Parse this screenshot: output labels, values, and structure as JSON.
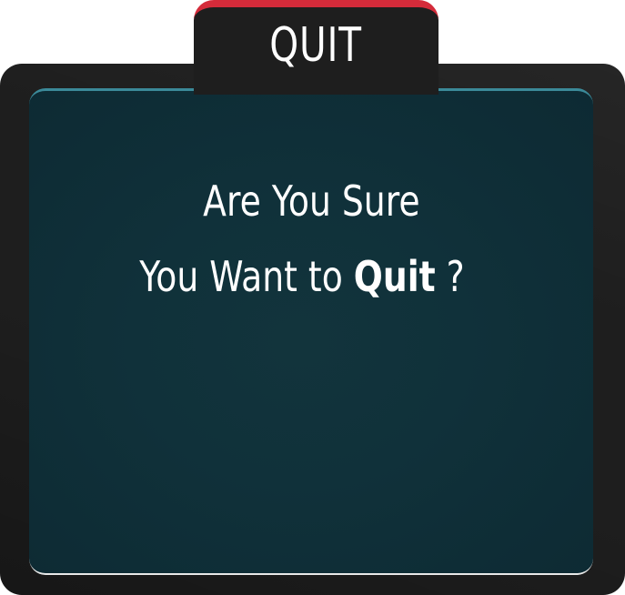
{
  "dialog": {
    "title": "QUIT",
    "message_line1": "Are You Sure",
    "message_line2_prefix": "You Want to",
    "message_line2_emphasis": "Quit",
    "message_line2_suffix": "?"
  },
  "colors": {
    "frame": "#1e1e1e",
    "tab_accent": "#d42b3a",
    "panel": "#10313a",
    "panel_top_border": "#3b8a99",
    "text": "#ffffff"
  }
}
